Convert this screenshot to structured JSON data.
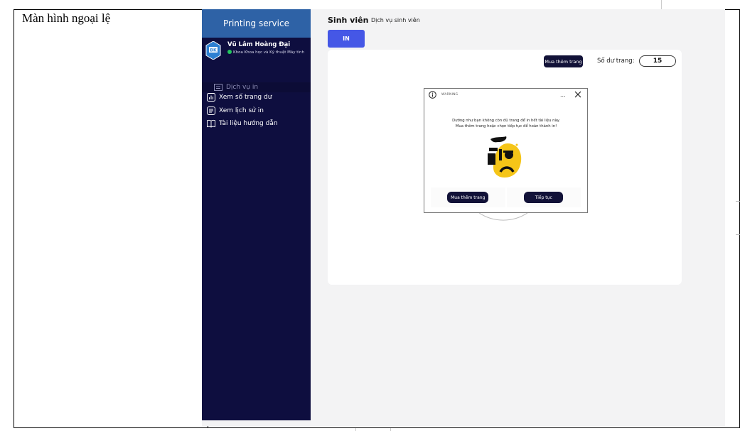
{
  "document": {
    "row_label": "Màn hình ngoại lệ"
  },
  "app": {
    "sidebar": {
      "title": "Printing service",
      "user_name": "Vũ Lâm Hoàng Đại",
      "user_department": "Khoa Khoa học và Kỹ thuật Máy tính",
      "logo_text": "BK",
      "items": [
        {
          "label": "Dịch vụ in",
          "icon": "printer-icon",
          "active": true
        },
        {
          "label": "Xem số trang dư",
          "icon": "chart-icon",
          "active": false
        },
        {
          "label": "Xem lịch sử in",
          "icon": "document-icon",
          "active": false
        },
        {
          "label": "Tài liệu hướng dẫn",
          "icon": "book-icon",
          "active": false
        }
      ]
    },
    "header": {
      "title": "Sinh viên",
      "subtitle": "Dịch vụ sinh viên"
    },
    "in_button": "IN",
    "panel": {
      "buy_button": "Mua thêm trang",
      "pages_label": "Số dư trang:",
      "pages_value": "15"
    },
    "modal": {
      "label": "WARNING",
      "more": "...",
      "message_line1": "Dường như bạn không còn đủ trang để in hết tài liệu này.",
      "message_line2": "Mua thêm trang hoặc chọn tiếp tục để hoàn thành in!",
      "buy_button": "Mua thêm trang",
      "continue_button": "Tiếp tục"
    },
    "colors": {
      "sidebar_bg": "#0e0e3f",
      "header_bg": "#2e62a6",
      "accent": "#4557e6",
      "dark_button": "#121238",
      "online": "#22c55e",
      "face_yellow": "#f5c518"
    }
  }
}
